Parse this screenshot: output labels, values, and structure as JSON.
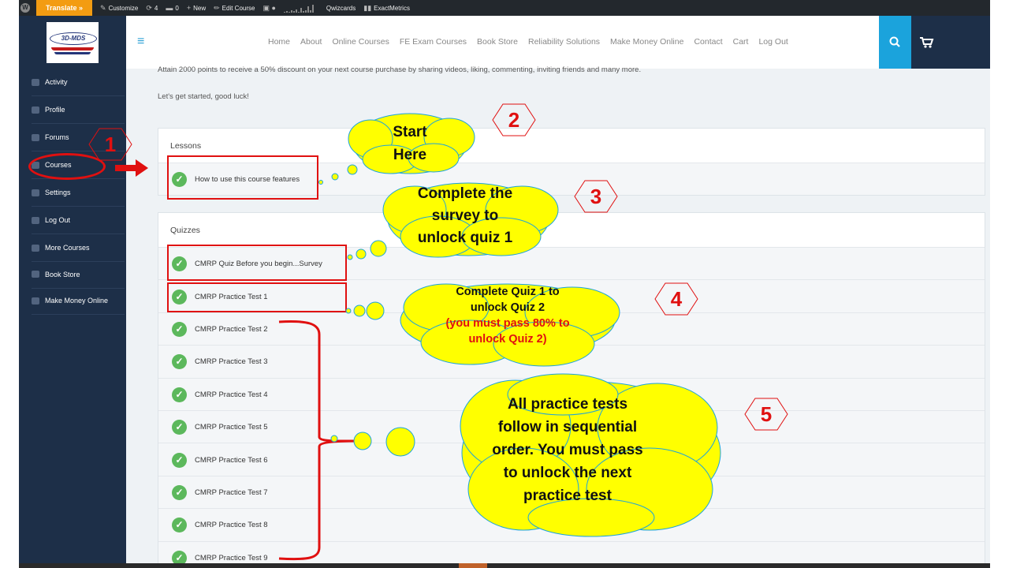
{
  "adminbar": {
    "translate": "Translate »",
    "customize": "Customize",
    "updates": "4",
    "comments": "0",
    "new": "New",
    "edit_course": "Edit Course",
    "qwizcards": "Qwizcards",
    "exactmetrics": "ExactMetrics"
  },
  "logo": {
    "text": "3D-MDS"
  },
  "nav": [
    "Home",
    "About",
    "Online Courses",
    "FE Exam Courses",
    "Book Store",
    "Reliability Solutions",
    "Make Money Online",
    "Contact",
    "Cart",
    "Log Out"
  ],
  "sidebar": {
    "items": [
      "Activity",
      "Profile",
      "Forums",
      "Courses",
      "Settings",
      "Log Out",
      "More Courses",
      "Book Store",
      "Make Money Online"
    ]
  },
  "content": {
    "intro": "Attain 2000 points to receive a 50% discount on your next course purchase by sharing videos, liking, commenting, inviting friends and many more.",
    "intro2": "Let's get started, good luck!",
    "lessons_title": "Lessons",
    "lessons": [
      "How to use this course features"
    ],
    "quizzes_title": "Quizzes",
    "quizzes": [
      "CMRP Quiz Before you begin...Survey",
      "CMRP Practice Test 1",
      "CMRP Practice Test 2",
      "CMRP Practice Test 3",
      "CMRP Practice Test 4",
      "CMRP Practice Test 5",
      "CMRP Practice Test 6",
      "CMRP Practice Test 7",
      "CMRP Practice Test 8",
      "CMRP Practice Test 9"
    ]
  },
  "annotations": {
    "n1": "1",
    "n2": "2",
    "n3": "3",
    "n4": "4",
    "n5": "5",
    "c2_line1": "Start",
    "c2_line2": "Here",
    "c3_line1": "Complete the",
    "c3_line2": "survey to",
    "c3_line3": "unlock quiz 1",
    "c4_line1": "Complete Quiz 1 to",
    "c4_line2": "unlock Quiz 2",
    "c4_line3": "(you must pass 80% to",
    "c4_line4": "unlock Quiz 2)",
    "c5_line1": "All practice tests",
    "c5_line2": "follow in sequential",
    "c5_line3": "order. You must pass",
    "c5_line4": "to unlock the next",
    "c5_line5": "practice test"
  },
  "colors": {
    "sidebar_bg": "#1d2f48",
    "accent": "#1ba3dc",
    "annotation_red": "#e01010",
    "cloud_yellow": "#ffff00",
    "check_green": "#5cb85c"
  }
}
